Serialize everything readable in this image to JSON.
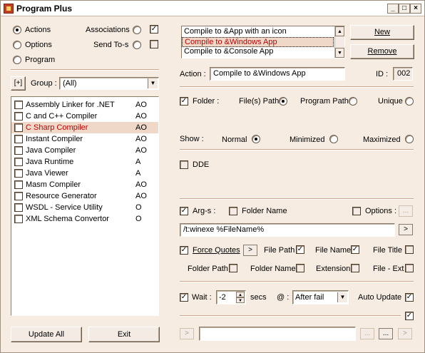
{
  "window": {
    "title": "Program Plus"
  },
  "left": {
    "radios": [
      {
        "label": "Actions",
        "checked": true
      },
      {
        "label": "Options",
        "checked": false
      },
      {
        "label": "Program",
        "checked": false
      }
    ],
    "associations": {
      "label": "Associations",
      "radio": false,
      "check": true
    },
    "send_to": {
      "label": "Send To-s",
      "radio": false,
      "check": false
    },
    "group": {
      "button": "[+]",
      "label": "Group :",
      "value": "(All)"
    },
    "programs": [
      {
        "name": "Assembly Linker for .NET",
        "code": "AO",
        "selected": false
      },
      {
        "name": "C and C++ Compiler",
        "code": "AO",
        "selected": false
      },
      {
        "name": "C Sharp Compiler",
        "code": "AO",
        "selected": true
      },
      {
        "name": "Instant Compiler",
        "code": "AO",
        "selected": false
      },
      {
        "name": "Java Compiler",
        "code": "AO",
        "selected": false
      },
      {
        "name": "Java Runtime",
        "code": "A",
        "selected": false
      },
      {
        "name": "Java Viewer",
        "code": "A",
        "selected": false
      },
      {
        "name": "Masm Compiler",
        "code": "AO",
        "selected": false
      },
      {
        "name": "Resource Generator",
        "code": "AO",
        "selected": false
      },
      {
        "name": "WSDL - Service Utility",
        "code": "O",
        "selected": false
      },
      {
        "name": "XML Schema Convertor",
        "code": "O",
        "selected": false
      }
    ],
    "update_all": "Update All",
    "exit": "Exit"
  },
  "right": {
    "actions_list": [
      {
        "text": "Compile to &App with an icon",
        "selected": false
      },
      {
        "text": "Compile to &Windows App",
        "selected": true
      },
      {
        "text": "Compile to &Console App",
        "selected": false
      }
    ],
    "new_button": "New",
    "remove_button": "Remove",
    "action_label": "Action :",
    "action_value": "Compile to &Windows App",
    "id_label": "ID :",
    "id_value": "002",
    "folder": {
      "label": "Folder :",
      "checked": true
    },
    "files_path": {
      "label": "File(s) Path",
      "checked": true
    },
    "program_path": {
      "label": "Program Path",
      "checked": false
    },
    "unique": {
      "label": "Unique",
      "checked": false
    },
    "show_label": "Show :",
    "show_normal": {
      "label": "Normal",
      "checked": true
    },
    "show_minimized": {
      "label": "Minimized",
      "checked": false
    },
    "show_maximized": {
      "label": "Maximized",
      "checked": false
    },
    "dde": {
      "label": "DDE",
      "checked": false
    },
    "args": {
      "label": "Arg-s :",
      "checked": true
    },
    "folder_name": {
      "label": "Folder Name",
      "checked": false
    },
    "options": {
      "label": "Options :",
      "checked": false
    },
    "options_btn": "...",
    "args_value": "/t:winexe %FileName%",
    "args_go": ">",
    "force_quotes": {
      "label": "Force Quotes",
      "checked": true
    },
    "fq_btn": ">",
    "fq_file_path": {
      "label": "File Path",
      "checked": true
    },
    "fq_file_name": {
      "label": "File Name",
      "checked": true
    },
    "fq_file_title": {
      "label": "File Title",
      "checked": false
    },
    "fq_folder_path": {
      "label": "Folder Path",
      "checked": false
    },
    "fq_folder_name": {
      "label": "Folder Name",
      "checked": false
    },
    "fq_extension": {
      "label": "Extension",
      "checked": false
    },
    "fq_file_ext": {
      "label": "File - Ext",
      "checked": false
    },
    "wait": {
      "label": "Wait :",
      "checked": true
    },
    "wait_value": "-2",
    "secs_label": "secs",
    "at_label": "@ :",
    "at_value": "After fail",
    "auto_update": {
      "label": "Auto Update",
      "checked": true
    },
    "bottom_check": true,
    "bottom_left": ">",
    "bottom_btn1": "...",
    "bottom_btn2": "...",
    "bottom_right": ">"
  }
}
